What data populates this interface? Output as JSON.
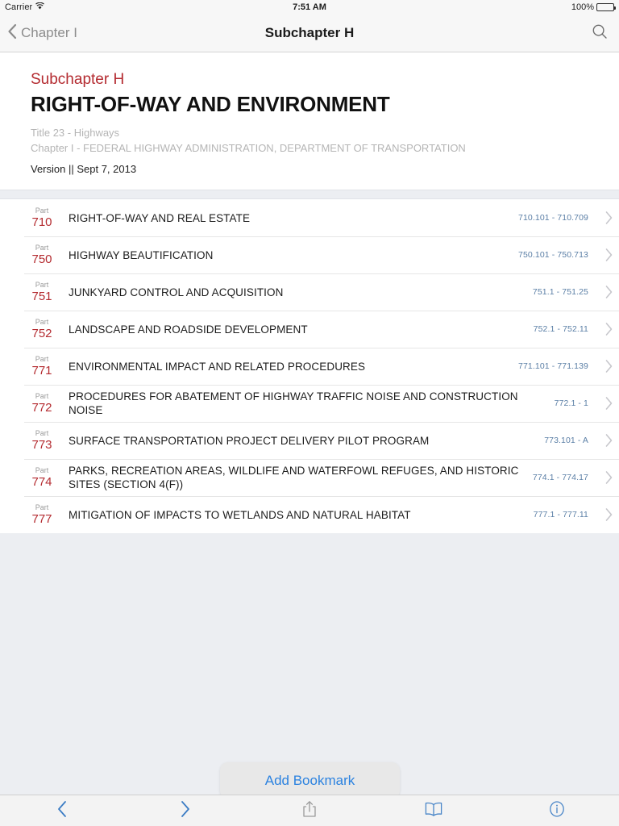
{
  "status_bar": {
    "carrier": "Carrier",
    "wifi_icon": "wifi-icon",
    "time": "7:51 AM",
    "battery_percent": "100%",
    "battery_icon": "battery-full-icon"
  },
  "nav_bar": {
    "back_icon": "chevron-left-icon",
    "back_label": "Chapter I",
    "title": "Subchapter H",
    "search_icon": "search-icon"
  },
  "header": {
    "subchapter_label": "Subchapter H",
    "title": "RIGHT-OF-WAY AND ENVIRONMENT",
    "title_line": "Title 23 - Highways",
    "chapter_line": "Chapter I - FEDERAL HIGHWAY ADMINISTRATION, DEPARTMENT OF TRANSPORTATION",
    "version_line": "Version || Sept 7, 2013"
  },
  "list": {
    "part_word": "Part",
    "chevron_icon": "chevron-right-icon",
    "rows": [
      {
        "part": "710",
        "title": "RIGHT-OF-WAY AND REAL ESTATE",
        "range": "710.101 - 710.709"
      },
      {
        "part": "750",
        "title": "HIGHWAY BEAUTIFICATION",
        "range": "750.101 - 750.713"
      },
      {
        "part": "751",
        "title": "JUNKYARD CONTROL AND ACQUISITION",
        "range": "751.1 - 751.25"
      },
      {
        "part": "752",
        "title": "LANDSCAPE AND ROADSIDE DEVELOPMENT",
        "range": "752.1 - 752.11"
      },
      {
        "part": "771",
        "title": "ENVIRONMENTAL IMPACT AND RELATED PROCEDURES",
        "range": "771.101 - 771.139"
      },
      {
        "part": "772",
        "title": "PROCEDURES FOR ABATEMENT OF HIGHWAY TRAFFIC NOISE AND CONSTRUCTION NOISE",
        "range": "772.1 - 1"
      },
      {
        "part": "773",
        "title": "SURFACE TRANSPORTATION PROJECT DELIVERY PILOT PROGRAM",
        "range": "773.101 - A"
      },
      {
        "part": "774",
        "title": "PARKS, RECREATION AREAS, WILDLIFE AND WATERFOWL REFUGES, AND HISTORIC SITES (SECTION 4(F))",
        "range": "774.1 - 774.17"
      },
      {
        "part": "777",
        "title": "MITIGATION OF IMPACTS TO WETLANDS AND NATURAL HABITAT",
        "range": "777.1 - 777.11"
      }
    ]
  },
  "popover": {
    "label": "Add Bookmark"
  },
  "toolbar": {
    "buttons": [
      {
        "name": "back-button",
        "icon": "chevron-left-icon"
      },
      {
        "name": "forward-button",
        "icon": "chevron-right-icon"
      },
      {
        "name": "share-button",
        "icon": "share-icon"
      },
      {
        "name": "bookmarks-button",
        "icon": "book-icon"
      },
      {
        "name": "info-button",
        "icon": "info-icon"
      }
    ]
  },
  "colors": {
    "accent_red": "#b42b30",
    "link_blue": "#2b82e0",
    "range_blue": "#5b7fa6",
    "background_gray": "#eceef2"
  }
}
